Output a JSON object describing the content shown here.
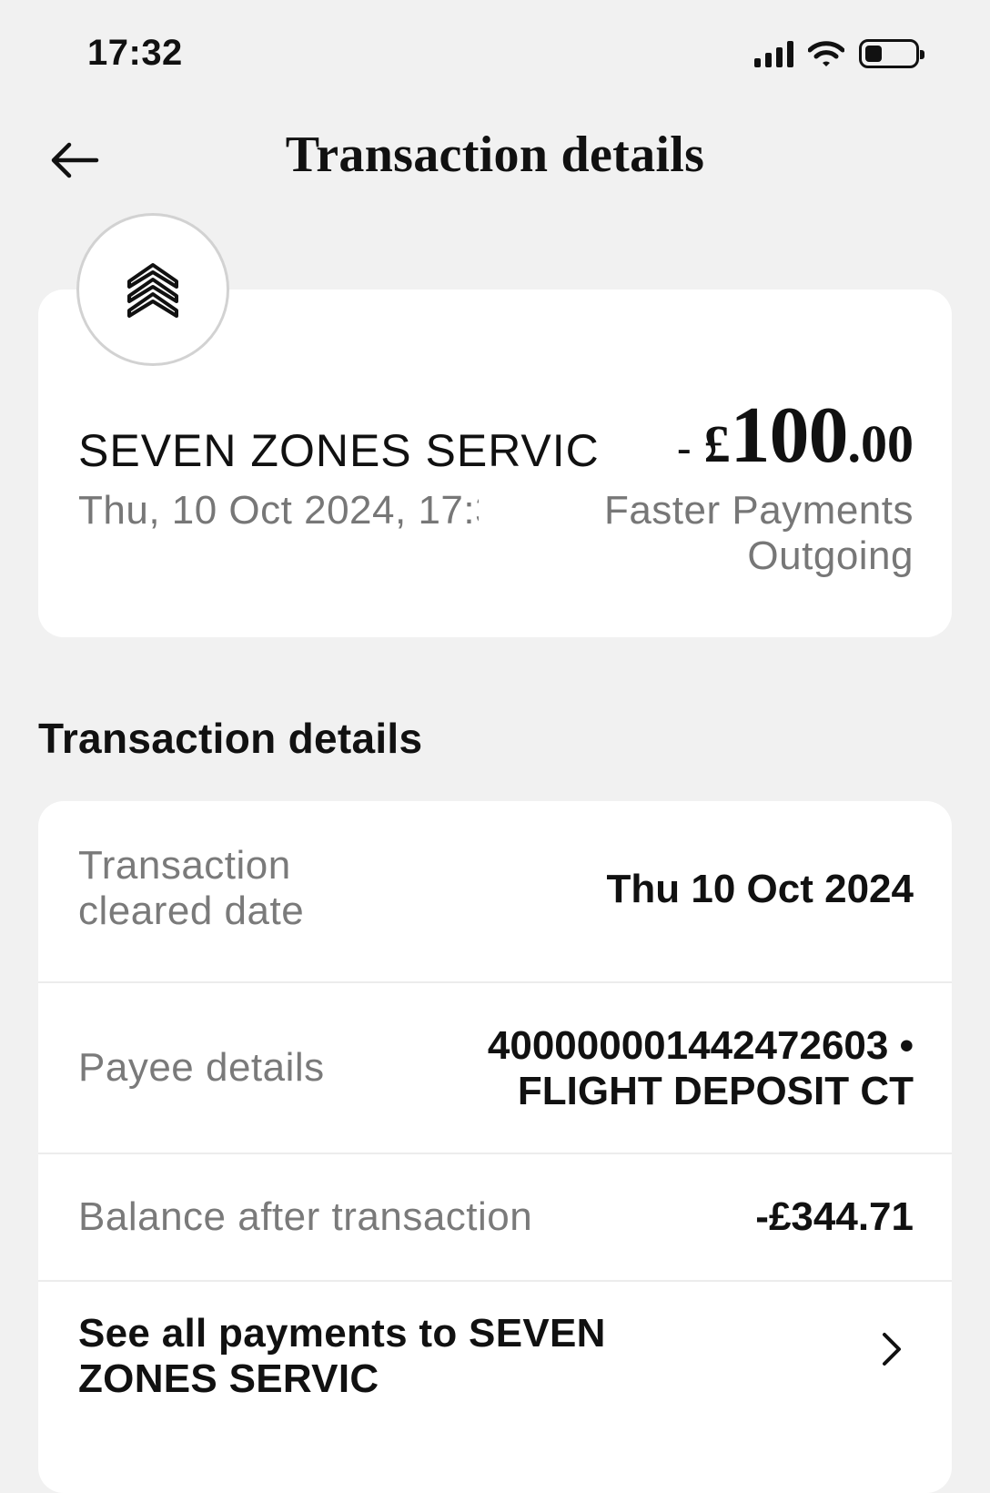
{
  "status_bar": {
    "time": "17:32"
  },
  "header": {
    "title": "Transaction details"
  },
  "summary": {
    "merchant": "SEVEN ZONES SERVIC",
    "datetime": "Thu, 10 Oct 2024, 17:3",
    "amount_sign": "-",
    "amount_currency": "£",
    "amount_major": "100",
    "amount_minor": ".00",
    "payment_type": "Faster Payments Outgoing"
  },
  "section": {
    "heading": "Transaction details"
  },
  "details": {
    "rows": [
      {
        "label": "Transaction cleared date",
        "value": "Thu 10 Oct 2024"
      },
      {
        "label": "Payee details",
        "value": "40000000144247260​3 • FLIGHT DEPOSIT CT"
      },
      {
        "label": "Balance after transaction",
        "value": "-£344.71"
      }
    ],
    "see_all_label": "See all payments to SEVEN ZONES SERVIC"
  }
}
